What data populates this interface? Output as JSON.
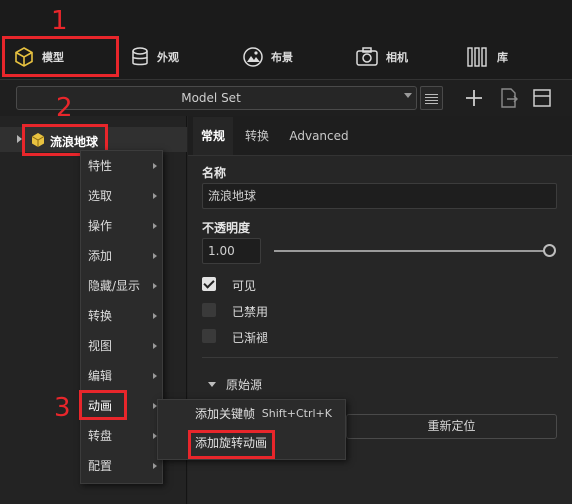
{
  "toolbar": {
    "items": [
      {
        "label": "模型",
        "icon": "cube-icon"
      },
      {
        "label": "外观",
        "icon": "database-icon"
      },
      {
        "label": "布景",
        "icon": "image-icon"
      },
      {
        "label": "相机",
        "icon": "camera-icon"
      },
      {
        "label": "库",
        "icon": "library-books-icon"
      }
    ]
  },
  "model_set": {
    "selected": "Model Set"
  },
  "tree": {
    "node_label": "流浪地球"
  },
  "context_menu": {
    "items": [
      "特性",
      "选取",
      "操作",
      "添加",
      "隐藏/显示",
      "转换",
      "视图",
      "编辑",
      "动画",
      "转盘",
      "配置"
    ]
  },
  "submenu": {
    "items": [
      {
        "label": "添加关键帧",
        "shortcut": "Shift+Ctrl+K"
      },
      {
        "label": "添加旋转动画",
        "shortcut": ""
      }
    ],
    "relocate_label": "重新定位"
  },
  "panel": {
    "tabs": [
      "常规",
      "转换",
      "Advanced"
    ],
    "name_label": "名称",
    "name_value": "流浪地球",
    "opacity_label": "不透明度",
    "opacity_value": "1.00",
    "opacity_level": 1.0,
    "checks": [
      {
        "label": "可见",
        "checked": true
      },
      {
        "label": "已禁用",
        "checked": false
      },
      {
        "label": "已渐褪",
        "checked": false
      }
    ],
    "origin_label": "原始源"
  },
  "annotations": {
    "step1": "1",
    "step2": "2",
    "step3": "3"
  },
  "colors": {
    "annotation_red": "#e8262b",
    "cube_yellow": "#e8c240"
  }
}
